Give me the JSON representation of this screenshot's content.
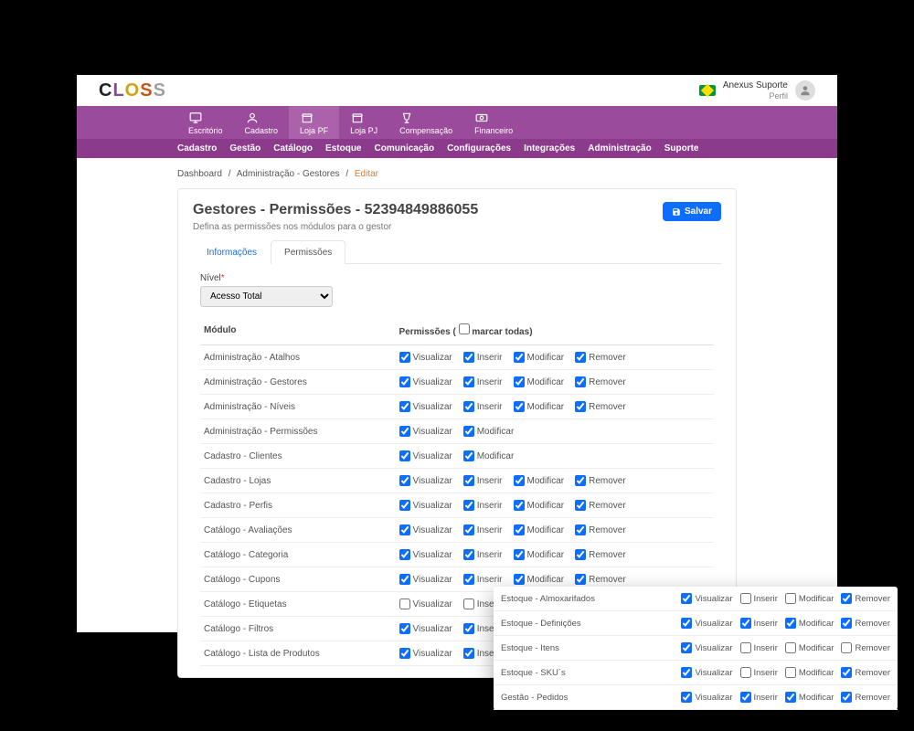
{
  "header": {
    "user_name": "Anexus Suporte",
    "user_sub": "Perfil"
  },
  "nav1": [
    {
      "label": "Escritório"
    },
    {
      "label": "Cadastro"
    },
    {
      "label": "Loja PF"
    },
    {
      "label": "Loja PJ"
    },
    {
      "label": "Compensação"
    },
    {
      "label": "Financeiro"
    }
  ],
  "nav2": [
    {
      "label": "Cadastro"
    },
    {
      "label": "Gestão"
    },
    {
      "label": "Catálogo"
    },
    {
      "label": "Estoque"
    },
    {
      "label": "Comunicação"
    },
    {
      "label": "Configurações"
    },
    {
      "label": "Integrações"
    },
    {
      "label": "Administração"
    },
    {
      "label": "Suporte"
    }
  ],
  "breadcrumb": {
    "a": "Dashboard",
    "b": "Administração - Gestores",
    "c": "Editar"
  },
  "panel": {
    "title": "Gestores - Permissões - 52394849886055",
    "subtitle": "Defina as permissões nos módulos para o gestor",
    "save": "Salvar"
  },
  "tabs": {
    "info": "Informações",
    "perm": "Permissões"
  },
  "level": {
    "label": "Nível",
    "value": "Acesso Total"
  },
  "thead": {
    "module": "Módulo",
    "perms": "Permissões (",
    "mark_all": "marcar todas",
    "close": ")"
  },
  "perm_labels": {
    "view": "Visualizar",
    "insert": "Inserir",
    "modify": "Modificar",
    "remove": "Remover"
  },
  "rows": [
    {
      "name": "Administração - Atalhos",
      "p": {
        "view": true,
        "insert": true,
        "modify": true,
        "remove": true
      }
    },
    {
      "name": "Administração - Gestores",
      "p": {
        "view": true,
        "insert": true,
        "modify": true,
        "remove": true
      }
    },
    {
      "name": "Administração - Níveis",
      "p": {
        "view": true,
        "insert": true,
        "modify": true,
        "remove": true
      }
    },
    {
      "name": "Administração - Permissões",
      "p": {
        "view": true,
        "modify": true
      }
    },
    {
      "name": "Cadastro - Clientes",
      "p": {
        "view": true,
        "modify": true
      }
    },
    {
      "name": "Cadastro - Lojas",
      "p": {
        "view": true,
        "insert": true,
        "modify": true,
        "remove": true
      }
    },
    {
      "name": "Cadastro - Perfis",
      "p": {
        "view": true,
        "insert": true,
        "modify": true,
        "remove": true
      }
    },
    {
      "name": "Catálogo - Avaliações",
      "p": {
        "view": true,
        "insert": true,
        "modify": true,
        "remove": true
      }
    },
    {
      "name": "Catálogo - Categoria",
      "p": {
        "view": true,
        "insert": true,
        "modify": true,
        "remove": true
      }
    },
    {
      "name": "Catálogo - Cupons",
      "p": {
        "view": true,
        "insert": true,
        "modify": true,
        "remove": true
      }
    },
    {
      "name": "Catálogo - Etiquetas",
      "p": {
        "view": false,
        "insert": false,
        "modify": false,
        "remove": false
      }
    },
    {
      "name": "Catálogo - Filtros",
      "p": {
        "view": true,
        "insert": true,
        "modify": true,
        "remove": true
      }
    },
    {
      "name": "Catálogo - Lista de Produtos",
      "p": {
        "view": true,
        "insert": true
      }
    }
  ],
  "float_rows": [
    {
      "name": "Estoque - Almoxarifados",
      "p": {
        "view": true,
        "insert": false,
        "modify": false,
        "remove": true
      }
    },
    {
      "name": "Estoque - Definições",
      "p": {
        "view": true,
        "insert": true,
        "modify": true,
        "remove": true
      }
    },
    {
      "name": "Estoque - Itens",
      "p": {
        "view": true,
        "insert": false,
        "modify": false,
        "remove": false
      }
    },
    {
      "name": "Estoque - SKU´s",
      "p": {
        "view": true,
        "insert": false,
        "modify": false,
        "remove": true
      }
    },
    {
      "name": "Gestão - Pedidos",
      "p": {
        "view": true,
        "insert": true,
        "modify": true,
        "remove": true
      }
    }
  ]
}
